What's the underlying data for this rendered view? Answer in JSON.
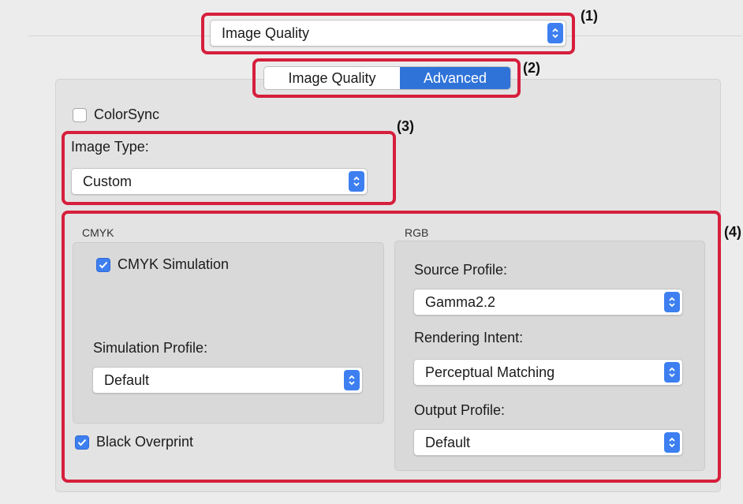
{
  "top_select": {
    "value": "Image Quality"
  },
  "segmented": {
    "items": [
      {
        "label": "Image Quality"
      },
      {
        "label": "Advanced"
      }
    ]
  },
  "colorsync": {
    "label": "ColorSync",
    "checked": false
  },
  "image_type": {
    "label": "Image Type:",
    "value": "Custom"
  },
  "cmyk": {
    "header": "CMYK",
    "simulation_label": "CMYK Simulation",
    "simulation_checked": true,
    "profile_label": "Simulation Profile:",
    "profile_value": "Default"
  },
  "rgb": {
    "header": "RGB",
    "source_label": "Source Profile:",
    "source_value": "Gamma2.2",
    "intent_label": "Rendering Intent:",
    "intent_value": "Perceptual Matching",
    "output_label": "Output Profile:",
    "output_value": "Default"
  },
  "black_overprint": {
    "label": "Black Overprint",
    "checked": true
  },
  "callouts": {
    "c1": "(1)",
    "c2": "(2)",
    "c3": "(3)",
    "c4": "(4)"
  },
  "colors": {
    "accent": "#3d7ff0",
    "selected_segment": "#2f73d9",
    "callout_border": "#d61f3c"
  }
}
